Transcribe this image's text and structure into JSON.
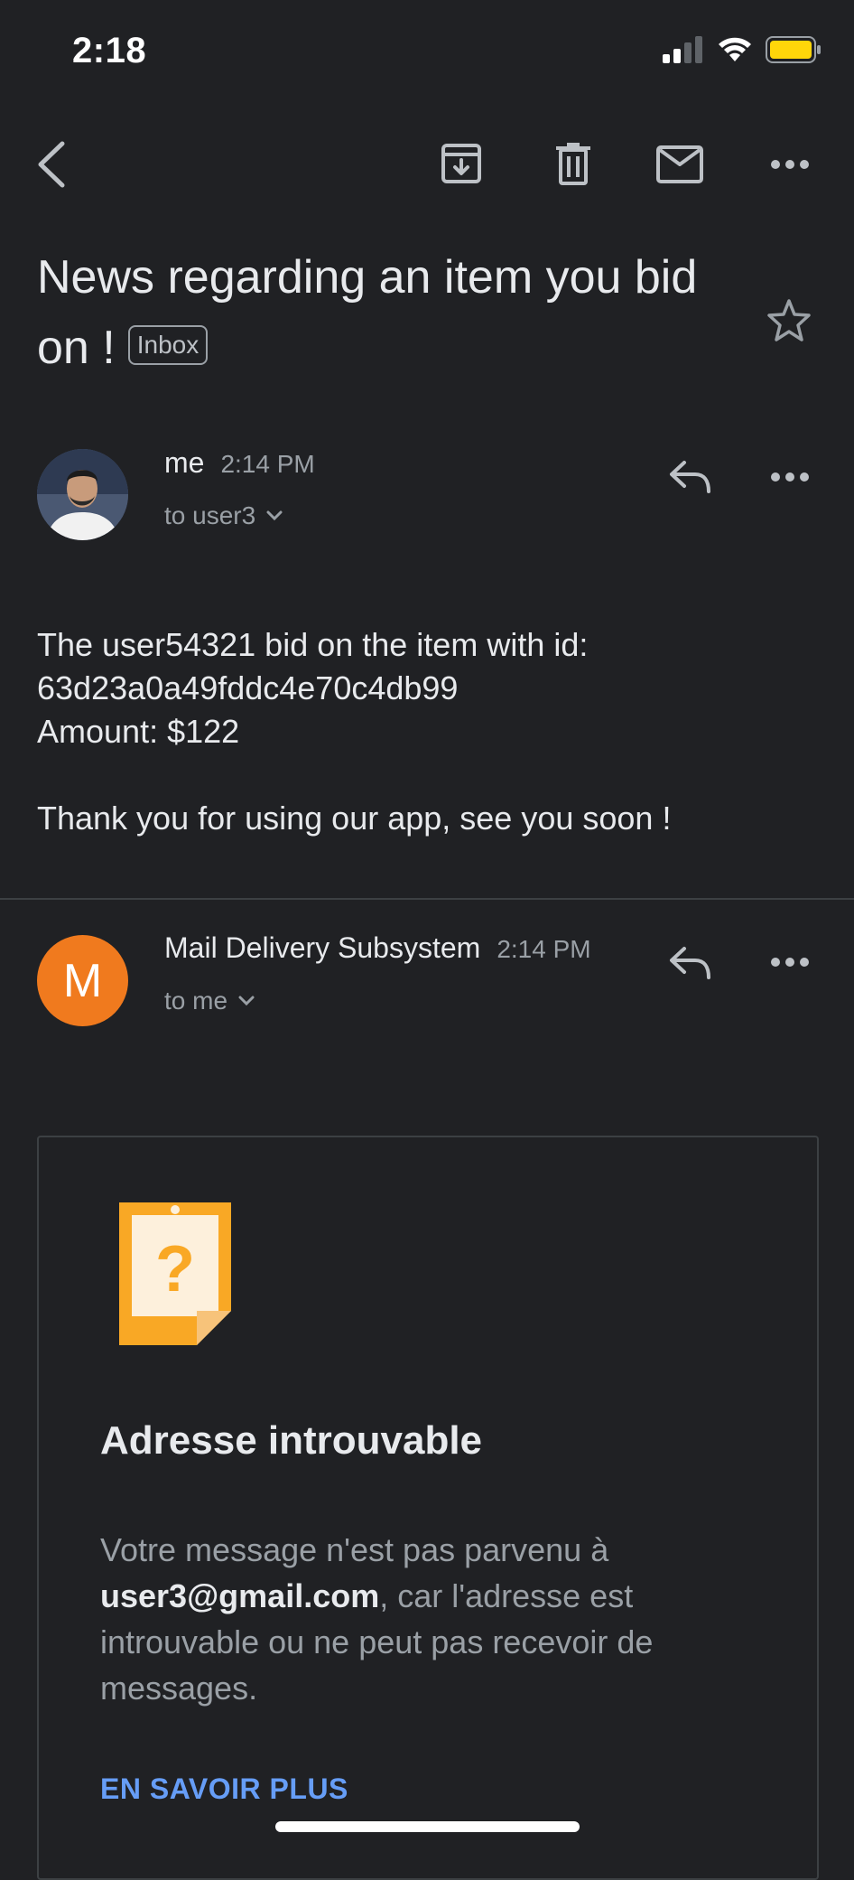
{
  "status_bar": {
    "time": "2:18"
  },
  "subject": {
    "text": "News regarding an item you bid on !",
    "label_chip": "Inbox"
  },
  "messages": [
    {
      "sender": "me",
      "time": "2:14 PM",
      "recipient": "to user3",
      "body": [
        "The user54321 bid on the item with id:",
        "63d23a0a49fddc4e70c4db99",
        "Amount: $122",
        "",
        "Thank you for using our app, see you soon !"
      ]
    },
    {
      "sender": "Mail Delivery Subsystem",
      "avatar_letter": "M",
      "time": "2:14 PM",
      "recipient": "to me"
    }
  ],
  "bounce_card": {
    "title": "Adresse introuvable",
    "text_before": "Votre message n'est pas parvenu à ",
    "email": "user3@gmail.com",
    "text_after": ", car l'adresse est introuvable ou ne peut pas recevoir de messages.",
    "link": "EN SAVOIR PLUS"
  },
  "colors": {
    "background": "#202124",
    "avatar_orange": "#f07a1e",
    "link_blue": "#669df6",
    "note_orange": "#f9a825",
    "battery": "#ffd60a"
  },
  "icons": [
    "back-icon",
    "archive-icon",
    "delete-icon",
    "mark-unread-icon",
    "more-icon",
    "star-icon",
    "reply-icon",
    "chevron-down-icon",
    "question-note-icon"
  ]
}
